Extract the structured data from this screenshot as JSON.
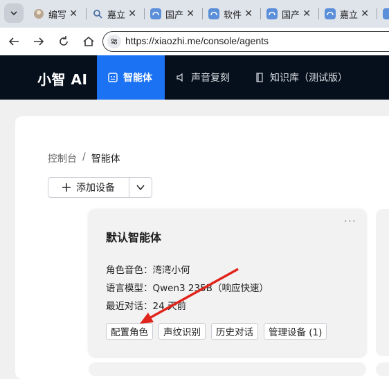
{
  "browser": {
    "tabs": [
      {
        "title": "编写",
        "icon": "avatar-icon"
      },
      {
        "title": "嘉立",
        "icon": "search-icon"
      },
      {
        "title": "国产",
        "icon": "cloud-icon"
      },
      {
        "title": "软件",
        "icon": "cloud-icon"
      },
      {
        "title": "国产",
        "icon": "cloud-icon"
      },
      {
        "title": "嘉立",
        "icon": "cloud-icon"
      }
    ],
    "url": "https://xiaozhi.me/console/agents"
  },
  "app": {
    "logo": "小智 AI",
    "nav": [
      {
        "label": "智能体",
        "active": true
      },
      {
        "label": "声音复刻",
        "active": false
      },
      {
        "label": "知识库（测试版）",
        "active": false
      }
    ]
  },
  "breadcrumb": {
    "root": "控制台",
    "sep": "/",
    "current": "智能体"
  },
  "add_device": {
    "label": "添加设备"
  },
  "agent_card": {
    "title": "默认智能体",
    "more": "···",
    "voice": "角色音色：湾湾小何",
    "model": "语言模型：Qwen3 235B（响应快速）",
    "recent": "最近对话：24 天前",
    "buttons": [
      "配置角色",
      "声纹识别",
      "历史对话",
      "管理设备 (1)"
    ]
  },
  "annotation": {
    "color": "#e0241b"
  },
  "colors": {
    "header_bg": "#06101c",
    "nav_active": "#1b72f2",
    "page_bg": "#f0f0f0"
  }
}
